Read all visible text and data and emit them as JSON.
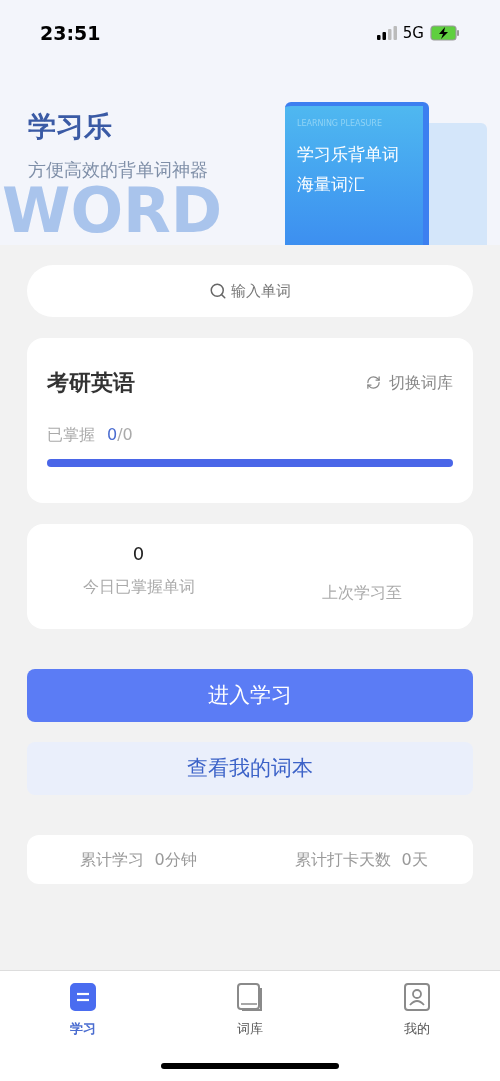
{
  "status_bar": {
    "time": "23:51",
    "network": "5G"
  },
  "banner": {
    "title": "学习乐",
    "subtitle": "方便高效的背单词神器",
    "bg_word": "WORD",
    "book": {
      "tag": "LEARNING PLEASURE",
      "line_1": "学习乐背单词",
      "line_2": "海量词汇"
    }
  },
  "search": {
    "placeholder": "输入单词"
  },
  "wordbook": {
    "title": "考研英语",
    "switch_label": "切换词库",
    "progress_label": "已掌握",
    "mastered": "0",
    "total": "/0",
    "level": 1
  },
  "today": {
    "count": "0",
    "label": "今日已掌握单词",
    "last_label": "上次学习至"
  },
  "buttons": [
    {
      "kind": "primary",
      "label": "进入学习"
    },
    {
      "kind": "secondary",
      "label": "查看我的词本"
    }
  ],
  "stats": [
    {
      "label": "累计学习",
      "value": "0分钟"
    },
    {
      "label": "累计打卡天数",
      "value": "0天"
    }
  ],
  "tabs": [
    {
      "label": "学习",
      "kind": "study",
      "selected": true
    },
    {
      "label": "词库",
      "kind": "library",
      "selected": false
    },
    {
      "label": "我的",
      "kind": "profile",
      "selected": false
    }
  ]
}
